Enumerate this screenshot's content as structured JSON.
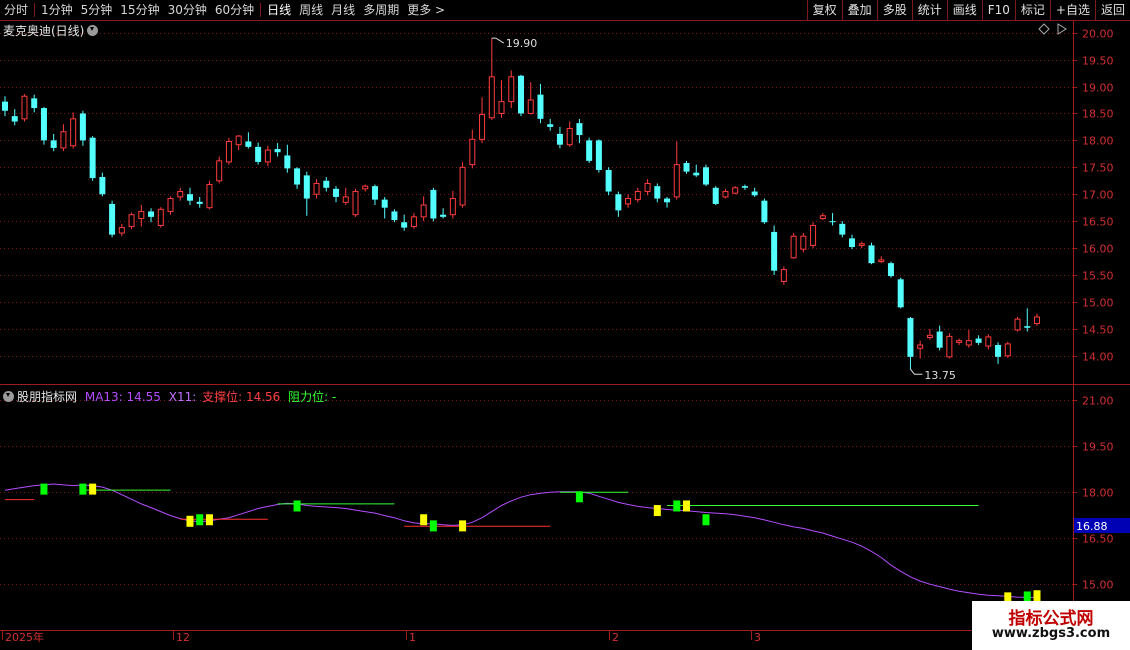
{
  "toolbar": {
    "periods": [
      "分时",
      "1分钟",
      "5分钟",
      "15分钟",
      "30分钟",
      "60分钟",
      "日线",
      "周线",
      "月线",
      "多周期",
      "更多 >"
    ],
    "active_period": "日线",
    "right_buttons": [
      "复权",
      "叠加",
      "多股",
      "统计",
      "画线",
      "F10",
      "标记",
      "+自选",
      "返回"
    ]
  },
  "main_panel": {
    "stock_title": "麦克奥迪(日线)",
    "high_label": "19.90",
    "low_label": "13.75"
  },
  "sub_panel": {
    "indicator_name": "股朋指标网",
    "ma_label": "MA13: 14.55",
    "x_label": "X11:",
    "support_label": "支撑位: 14.56",
    "resist_label": "阻力位: -",
    "price_marker": "16.88"
  },
  "time_axis": {
    "labels": [
      "2025年",
      "12",
      "1",
      "2",
      "3"
    ]
  },
  "logo": {
    "line1": "指标公式网",
    "line2": "www.zbgs3.com"
  },
  "colors": {
    "up": "#ff3c3c",
    "down": "#54ffff",
    "border": "#a01c1c",
    "grid": "#7a1515",
    "ma": "#b44dff",
    "support": "#ff3030",
    "resist": "#33ff33",
    "box_yellow": "#ffff00",
    "box_green": "#00ff00",
    "marker_bg": "#0000b4"
  },
  "chart_data": [
    {
      "type": "candlestick",
      "title": "麦克奥迪(日线)",
      "y_ticks": [
        20.0,
        19.5,
        19.0,
        18.5,
        18.0,
        17.5,
        17.0,
        16.5,
        16.0,
        15.5,
        15.0,
        14.5,
        14.0
      ],
      "ylim": [
        13.55,
        20.05
      ],
      "x_labels": [
        "2025年",
        "12",
        "1",
        "2",
        "3"
      ],
      "candles": [
        [
          18.72,
          18.55,
          18.82,
          18.45
        ],
        [
          18.45,
          18.35,
          18.58,
          18.28
        ],
        [
          18.4,
          18.82,
          18.86,
          18.35
        ],
        [
          18.78,
          18.6,
          18.85,
          18.52
        ],
        [
          18.6,
          18.0,
          18.62,
          17.92
        ],
        [
          18.0,
          17.86,
          18.12,
          17.8
        ],
        [
          17.86,
          18.16,
          18.3,
          17.8
        ],
        [
          17.9,
          18.4,
          18.52,
          17.85
        ],
        [
          18.5,
          18.0,
          18.55,
          17.9
        ],
        [
          18.05,
          17.3,
          18.08,
          17.25
        ],
        [
          17.32,
          17.0,
          17.4,
          16.96
        ],
        [
          16.82,
          16.25,
          16.88,
          16.2
        ],
        [
          16.28,
          16.38,
          16.45,
          16.22
        ],
        [
          16.4,
          16.62,
          16.66,
          16.35
        ],
        [
          16.55,
          16.68,
          16.8,
          16.4
        ],
        [
          16.68,
          16.58,
          16.74,
          16.48
        ],
        [
          16.42,
          16.72,
          16.76,
          16.38
        ],
        [
          16.68,
          16.92,
          16.96,
          16.62
        ],
        [
          16.95,
          17.05,
          17.12,
          16.88
        ],
        [
          17.0,
          16.88,
          17.12,
          16.8
        ],
        [
          16.86,
          16.82,
          16.95,
          16.75
        ],
        [
          16.75,
          17.18,
          17.25,
          16.72
        ],
        [
          17.25,
          17.62,
          17.7,
          17.2
        ],
        [
          17.6,
          17.98,
          18.05,
          17.55
        ],
        [
          17.92,
          18.08,
          18.1,
          17.82
        ],
        [
          17.98,
          17.88,
          18.15,
          17.85
        ],
        [
          17.88,
          17.6,
          17.96,
          17.55
        ],
        [
          17.6,
          17.82,
          17.9,
          17.52
        ],
        [
          17.84,
          17.78,
          17.95,
          17.7
        ],
        [
          17.72,
          17.48,
          17.92,
          17.4
        ],
        [
          17.48,
          17.18,
          17.5,
          17.1
        ],
        [
          17.35,
          16.92,
          17.42,
          16.6
        ],
        [
          17.0,
          17.2,
          17.28,
          16.92
        ],
        [
          17.25,
          17.12,
          17.32,
          17.05
        ],
        [
          17.1,
          16.95,
          17.15,
          16.85
        ],
        [
          16.85,
          16.95,
          17.12,
          16.8
        ],
        [
          16.62,
          17.05,
          17.1,
          16.58
        ],
        [
          17.1,
          17.15,
          17.18,
          17.05
        ],
        [
          17.15,
          16.9,
          17.18,
          16.8
        ],
        [
          16.9,
          16.75,
          16.95,
          16.55
        ],
        [
          16.68,
          16.52,
          16.72,
          16.48
        ],
        [
          16.48,
          16.38,
          16.62,
          16.32
        ],
        [
          16.4,
          16.58,
          16.65,
          16.36
        ],
        [
          16.58,
          16.8,
          16.96,
          16.5
        ],
        [
          17.08,
          16.55,
          17.12,
          16.5
        ],
        [
          16.62,
          16.58,
          16.74,
          16.55
        ],
        [
          16.62,
          16.92,
          17.06,
          16.55
        ],
        [
          16.8,
          17.5,
          17.6,
          16.75
        ],
        [
          17.55,
          18.02,
          18.2,
          17.48
        ],
        [
          18.02,
          18.48,
          18.8,
          17.95
        ],
        [
          18.42,
          19.18,
          19.9,
          18.38
        ],
        [
          18.5,
          18.72,
          19.12,
          18.42
        ],
        [
          18.72,
          19.18,
          19.3,
          18.6
        ],
        [
          19.2,
          18.5,
          19.22,
          18.45
        ],
        [
          18.5,
          18.75,
          19.08,
          18.48
        ],
        [
          18.85,
          18.4,
          19.05,
          18.32
        ],
        [
          18.3,
          18.25,
          18.4,
          18.18
        ],
        [
          18.12,
          17.92,
          18.25,
          17.85
        ],
        [
          17.92,
          18.22,
          18.35,
          17.88
        ],
        [
          18.32,
          18.1,
          18.4,
          17.95
        ],
        [
          18.0,
          17.62,
          18.05,
          17.58
        ],
        [
          18.0,
          17.45,
          18.02,
          17.4
        ],
        [
          17.45,
          17.05,
          17.5,
          16.98
        ],
        [
          17.0,
          16.7,
          17.05,
          16.58
        ],
        [
          16.82,
          16.92,
          17.0,
          16.75
        ],
        [
          16.9,
          17.05,
          17.12,
          16.85
        ],
        [
          17.05,
          17.2,
          17.28,
          16.98
        ],
        [
          17.15,
          16.92,
          17.2,
          16.85
        ],
        [
          16.92,
          16.85,
          16.95,
          16.75
        ],
        [
          16.95,
          17.55,
          17.98,
          16.9
        ],
        [
          17.58,
          17.42,
          17.62,
          17.38
        ],
        [
          17.4,
          17.35,
          17.55,
          17.32
        ],
        [
          17.5,
          17.18,
          17.55,
          17.15
        ],
        [
          17.12,
          16.82,
          17.15,
          16.8
        ],
        [
          16.95,
          17.05,
          17.1,
          16.92
        ],
        [
          17.02,
          17.12,
          17.15,
          17.0
        ],
        [
          17.15,
          17.12,
          17.18,
          17.08
        ],
        [
          17.05,
          16.98,
          17.12,
          16.95
        ],
        [
          16.88,
          16.48,
          16.92,
          16.45
        ],
        [
          16.3,
          15.58,
          16.42,
          15.5
        ],
        [
          15.38,
          15.6,
          15.66,
          15.32
        ],
        [
          15.82,
          16.22,
          16.28,
          15.8
        ],
        [
          15.98,
          16.22,
          16.28,
          15.92
        ],
        [
          16.05,
          16.42,
          16.48,
          16.0
        ],
        [
          16.55,
          16.6,
          16.65,
          16.52
        ],
        [
          16.5,
          16.48,
          16.65,
          16.42
        ],
        [
          16.45,
          16.25,
          16.5,
          16.2
        ],
        [
          16.18,
          16.02,
          16.25,
          15.98
        ],
        [
          16.05,
          16.08,
          16.12,
          16.0
        ],
        [
          16.05,
          15.72,
          16.1,
          15.7
        ],
        [
          15.75,
          15.78,
          15.85,
          15.72
        ],
        [
          15.72,
          15.48,
          15.75,
          15.45
        ],
        [
          15.42,
          14.9,
          15.45,
          14.88
        ],
        [
          14.7,
          13.98,
          14.72,
          13.75
        ],
        [
          14.14,
          14.2,
          14.28,
          13.95
        ],
        [
          14.34,
          14.38,
          14.5,
          14.3
        ],
        [
          14.45,
          14.15,
          14.56,
          14.1
        ],
        [
          13.98,
          14.36,
          14.42,
          13.95
        ],
        [
          14.25,
          14.28,
          14.32,
          14.2
        ],
        [
          14.2,
          14.28,
          14.48,
          14.15
        ],
        [
          14.32,
          14.24,
          14.38,
          14.2
        ],
        [
          14.18,
          14.35,
          14.4,
          14.12
        ],
        [
          14.2,
          13.98,
          14.25,
          13.85
        ],
        [
          14.0,
          14.22,
          14.26,
          13.96
        ],
        [
          14.48,
          14.68,
          14.72,
          14.45
        ],
        [
          14.55,
          14.52,
          14.88,
          14.45
        ],
        [
          14.6,
          14.72,
          14.78,
          14.56
        ]
      ]
    },
    {
      "type": "line",
      "title": "股朋指标网",
      "y_ticks": [
        21.0,
        19.5,
        18.0,
        16.5,
        15.0
      ],
      "ylim": [
        13.55,
        21.45
      ],
      "series": [
        {
          "name": "MA13",
          "values": [
            18.05,
            18.1,
            18.15,
            18.2,
            18.22,
            18.25,
            18.22,
            18.2,
            18.22,
            18.2,
            18.15,
            18.05,
            17.9,
            17.75,
            17.6,
            17.48,
            17.35,
            17.22,
            17.12,
            17.05,
            17.02,
            17.05,
            17.1,
            17.15,
            17.25,
            17.35,
            17.45,
            17.52,
            17.58,
            17.62,
            17.6,
            17.55,
            17.52,
            17.5,
            17.48,
            17.45,
            17.4,
            17.35,
            17.3,
            17.22,
            17.15,
            17.05,
            16.98,
            16.95,
            16.95,
            16.92,
            16.9,
            16.92,
            17.0,
            17.15,
            17.35,
            17.55,
            17.7,
            17.82,
            17.9,
            17.95,
            17.98,
            18.0,
            18.0,
            18.0,
            17.95,
            17.85,
            17.75,
            17.65,
            17.58,
            17.52,
            17.48,
            17.45,
            17.42,
            17.4,
            17.38,
            17.35,
            17.32,
            17.3,
            17.28,
            17.25,
            17.2,
            17.15,
            17.08,
            17.0,
            16.92,
            16.85,
            16.8,
            16.72,
            16.65,
            16.55,
            16.45,
            16.35,
            16.22,
            16.05,
            15.85,
            15.6,
            15.4,
            15.22,
            15.08,
            14.98,
            14.9,
            14.82,
            14.75,
            14.7,
            14.65,
            14.62,
            14.6,
            14.58,
            14.56,
            14.55,
            14.55
          ]
        }
      ]
    }
  ]
}
